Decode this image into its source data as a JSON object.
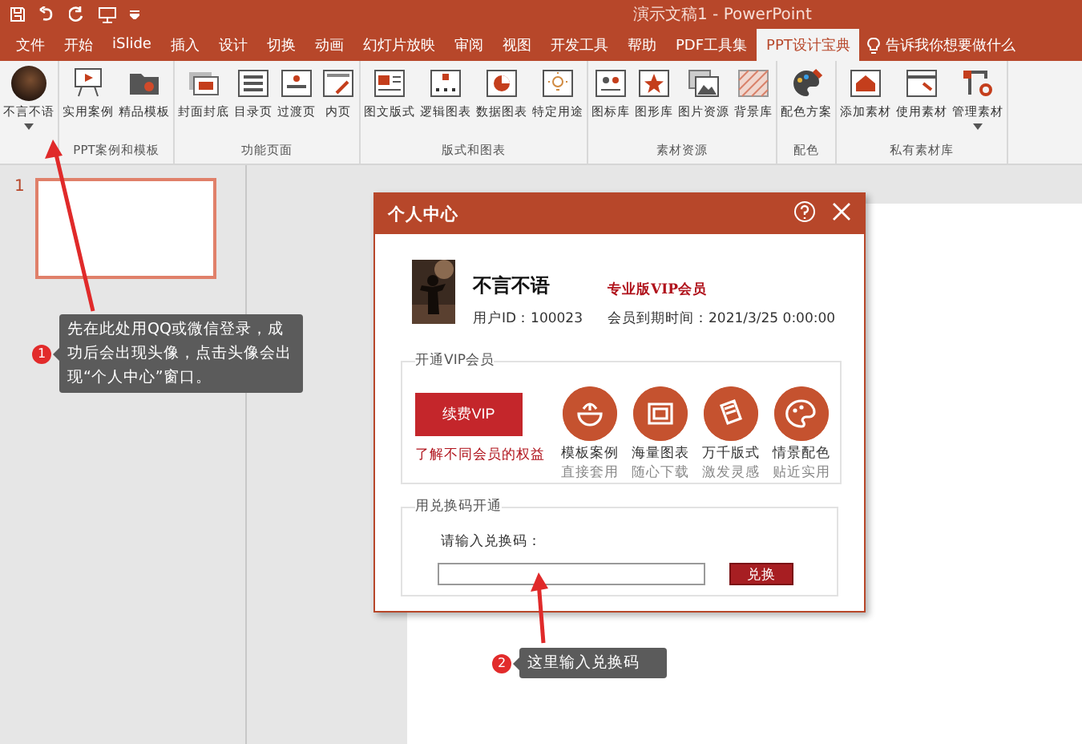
{
  "window": {
    "title": "演示文稿1  -  PowerPoint"
  },
  "tabs": [
    {
      "label": "文件",
      "selected": false
    },
    {
      "label": "开始",
      "selected": false
    },
    {
      "label": "iSlide",
      "selected": false
    },
    {
      "label": "插入",
      "selected": false
    },
    {
      "label": "设计",
      "selected": false
    },
    {
      "label": "切换",
      "selected": false
    },
    {
      "label": "动画",
      "selected": false
    },
    {
      "label": "幻灯片放映",
      "selected": false
    },
    {
      "label": "审阅",
      "selected": false
    },
    {
      "label": "视图",
      "selected": false
    },
    {
      "label": "开发工具",
      "selected": false
    },
    {
      "label": "帮助",
      "selected": false
    },
    {
      "label": "PDF工具集",
      "selected": false
    },
    {
      "label": "PPT设计宝典",
      "selected": true
    }
  ],
  "tell_me": {
    "placeholder": "告诉我你想要做什么"
  },
  "ribbon": {
    "account": {
      "label": "不言不语",
      "dropdown": true
    },
    "groups": [
      {
        "label": "PPT案例和模板",
        "buttons": [
          {
            "label": "实用案例",
            "dropdown": false
          },
          {
            "label": "精品模板",
            "dropdown": false
          }
        ]
      },
      {
        "label": "功能页面",
        "buttons": [
          {
            "label": "封面封底",
            "dropdown": false
          },
          {
            "label": "目录页",
            "dropdown": false
          },
          {
            "label": "过渡页",
            "dropdown": false
          },
          {
            "label": "内页",
            "dropdown": false
          }
        ]
      },
      {
        "label": "版式和图表",
        "buttons": [
          {
            "label": "图文版式",
            "dropdown": false
          },
          {
            "label": "逻辑图表",
            "dropdown": false
          },
          {
            "label": "数据图表",
            "dropdown": false
          },
          {
            "label": "特定用途",
            "dropdown": false
          }
        ]
      },
      {
        "label": "素材资源",
        "buttons": [
          {
            "label": "图标库",
            "dropdown": false
          },
          {
            "label": "图形库",
            "dropdown": false
          },
          {
            "label": "图片资源",
            "dropdown": false
          },
          {
            "label": "背景库",
            "dropdown": false
          }
        ]
      },
      {
        "label": "配色",
        "buttons": [
          {
            "label": "配色方案",
            "dropdown": false
          }
        ]
      },
      {
        "label": "私有素材库",
        "buttons": [
          {
            "label": "添加素材",
            "dropdown": false
          },
          {
            "label": "使用素材",
            "dropdown": false
          },
          {
            "label": "管理素材",
            "dropdown": true
          }
        ]
      }
    ]
  },
  "slides": [
    {
      "number": "1",
      "selected": true
    }
  ],
  "dialog": {
    "title": "个人中心",
    "user": {
      "name": "不言不语",
      "user_id": "用户ID：100023",
      "membership": "专业版VIP会员",
      "expiry": "会员到期时间：2021/3/25 0:00:00"
    },
    "vip": {
      "title": "开通VIP会员",
      "renew_button": "续费VIP",
      "benefits_link": "了解不同会员的权益",
      "features": [
        {
          "title": "模板案例",
          "subtitle": "直接套用"
        },
        {
          "title": "海量图表",
          "subtitle": "随心下载"
        },
        {
          "title": "万千版式",
          "subtitle": "激发灵感"
        },
        {
          "title": "情景配色",
          "subtitle": "贴近实用"
        }
      ]
    },
    "redeem": {
      "title": "用兑换码开通",
      "prompt": "请输入兑换码：",
      "button": "兑换"
    }
  },
  "callouts": [
    {
      "number": "1",
      "text": "先在此处用QQ或微信登录，成功后会出现头像，点击头像会出现“个人中心”窗口。"
    },
    {
      "number": "2",
      "text": "这里输入兑换码"
    }
  ]
}
